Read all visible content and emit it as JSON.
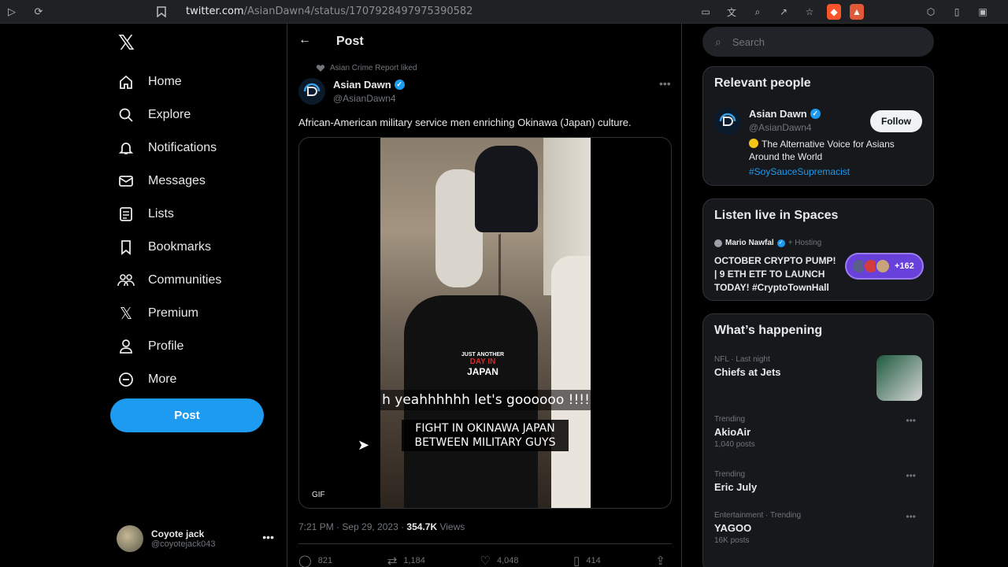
{
  "browser": {
    "url_host": "twitter.com",
    "url_path": "/AsianDawn4/status/1707928497975390582"
  },
  "nav": {
    "items": [
      {
        "label": "Home",
        "icon": "home-icon"
      },
      {
        "label": "Explore",
        "icon": "search-icon"
      },
      {
        "label": "Notifications",
        "icon": "bell-icon"
      },
      {
        "label": "Messages",
        "icon": "mail-icon"
      },
      {
        "label": "Lists",
        "icon": "list-icon"
      },
      {
        "label": "Bookmarks",
        "icon": "bookmark-icon"
      },
      {
        "label": "Communities",
        "icon": "communities-icon"
      },
      {
        "label": "Premium",
        "icon": "x-icon"
      },
      {
        "label": "Profile",
        "icon": "person-icon"
      },
      {
        "label": "More",
        "icon": "more-circle-icon"
      }
    ],
    "post_button": "Post",
    "user": {
      "name": "Coyote jack",
      "handle": "@coyotejack043"
    }
  },
  "post": {
    "header_title": "Post",
    "repost_label": "Asian Crime Report liked",
    "author_name": "Asian Dawn",
    "author_handle": "@AsianDawn4",
    "text": "African-American military service men enriching Okinawa (Japan) culture.",
    "video": {
      "shirt_line1": "JUST ANOTHER",
      "shirt_line2": "DAY IN",
      "shirt_line3": "JAPAN",
      "caption1": "h yeahhhhhh let's goooooo !!!!",
      "caption2_line1": "FIGHT IN OKINAWA JAPAN",
      "caption2_line2": "BETWEEN MILITARY GUYS"
    },
    "media_icon": "GIF",
    "timestamp": "7:21 PM · Sep 29, 2023 · ",
    "views_count": "354.7K",
    "views_label": " Views",
    "actions": {
      "replies": "821",
      "reposts": "1,184",
      "likes": "4,048",
      "bookmarks": "414"
    }
  },
  "sidebar": {
    "search_placeholder": "Search",
    "relevant": {
      "title": "Relevant people",
      "name": "Asian Dawn",
      "handle": "@AsianDawn4",
      "follow_label": "Follow",
      "bio": "The Alternative Voice for Asians Around the World",
      "tag": "#SoySauceSupremacist"
    },
    "spaces": {
      "title": "Listen live in Spaces",
      "host": "Mario Nawfal",
      "host_sub": "+ Hosting",
      "space_title": "OCTOBER CRYPTO PUMP! | 9 ETH ETF TO LAUNCH TODAY! #CryptoTownHall",
      "listeners": "+162"
    },
    "happening": {
      "title": "What’s happening",
      "trends": [
        {
          "category": "NFL · Last night",
          "name": "Chiefs at Jets",
          "count": ""
        },
        {
          "category": "Trending",
          "name": "AkioAir",
          "count": "1,040 posts"
        },
        {
          "category": "Trending",
          "name": "Eric July",
          "count": ""
        },
        {
          "category": "Entertainment · Trending",
          "name": "YAGOO",
          "count": "16K posts"
        }
      ]
    }
  },
  "colors": {
    "accent": "#1d9bf0",
    "background": "#000000",
    "card": "#16181c",
    "spaces_pill": "#6741d9"
  }
}
